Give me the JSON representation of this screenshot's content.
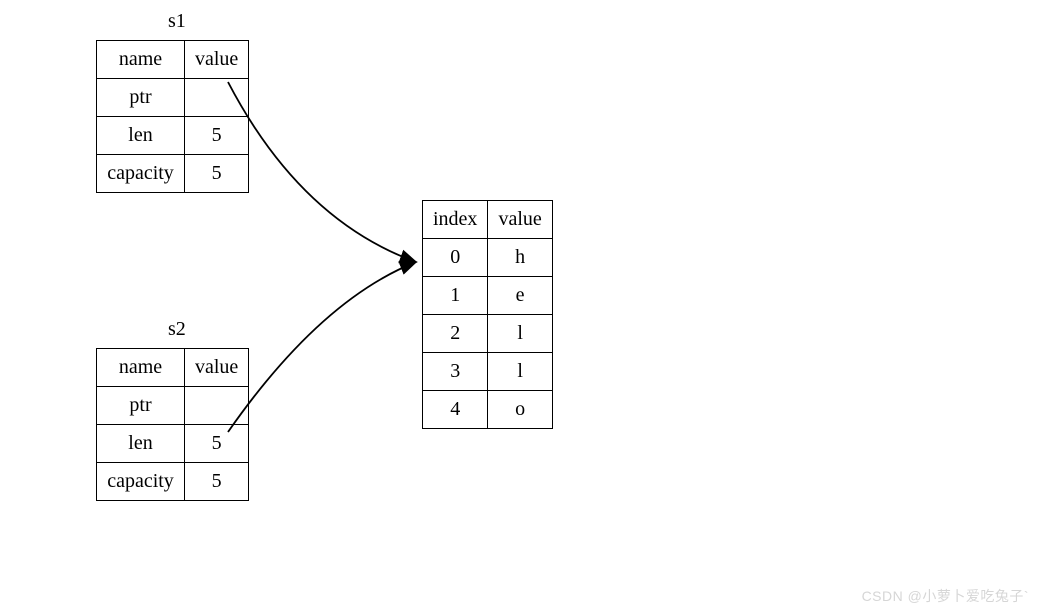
{
  "s1": {
    "title": "s1",
    "header": {
      "name": "name",
      "value": "value"
    },
    "rows": [
      {
        "name": "ptr",
        "value": ""
      },
      {
        "name": "len",
        "value": "5"
      },
      {
        "name": "capacity",
        "value": "5"
      }
    ]
  },
  "s2": {
    "title": "s2",
    "header": {
      "name": "name",
      "value": "value"
    },
    "rows": [
      {
        "name": "ptr",
        "value": ""
      },
      {
        "name": "len",
        "value": "5"
      },
      {
        "name": "capacity",
        "value": "5"
      }
    ]
  },
  "heap": {
    "header": {
      "index": "index",
      "value": "value"
    },
    "rows": [
      {
        "index": "0",
        "value": "h"
      },
      {
        "index": "1",
        "value": "e"
      },
      {
        "index": "2",
        "value": "l"
      },
      {
        "index": "3",
        "value": "l"
      },
      {
        "index": "4",
        "value": "o"
      }
    ]
  },
  "watermark": "CSDN @小萝卜爱吃兔子`",
  "chart_data": {
    "type": "table",
    "description": "Diagram of two Rust String structs (s1 and s2) whose ptr fields both point to the same heap-allocated buffer containing the characters of 'hello'. Each struct has fields ptr, len=5, capacity=5. The heap table lists index 0..4 mapped to h,e,l,l,o.",
    "structs": [
      {
        "name": "s1",
        "ptr": "->heap[0]",
        "len": 5,
        "capacity": 5
      },
      {
        "name": "s2",
        "ptr": "->heap[0]",
        "len": 5,
        "capacity": 5
      }
    ],
    "heap_buffer": [
      {
        "index": 0,
        "value": "h"
      },
      {
        "index": 1,
        "value": "e"
      },
      {
        "index": 2,
        "value": "l"
      },
      {
        "index": 3,
        "value": "l"
      },
      {
        "index": 4,
        "value": "o"
      }
    ]
  }
}
